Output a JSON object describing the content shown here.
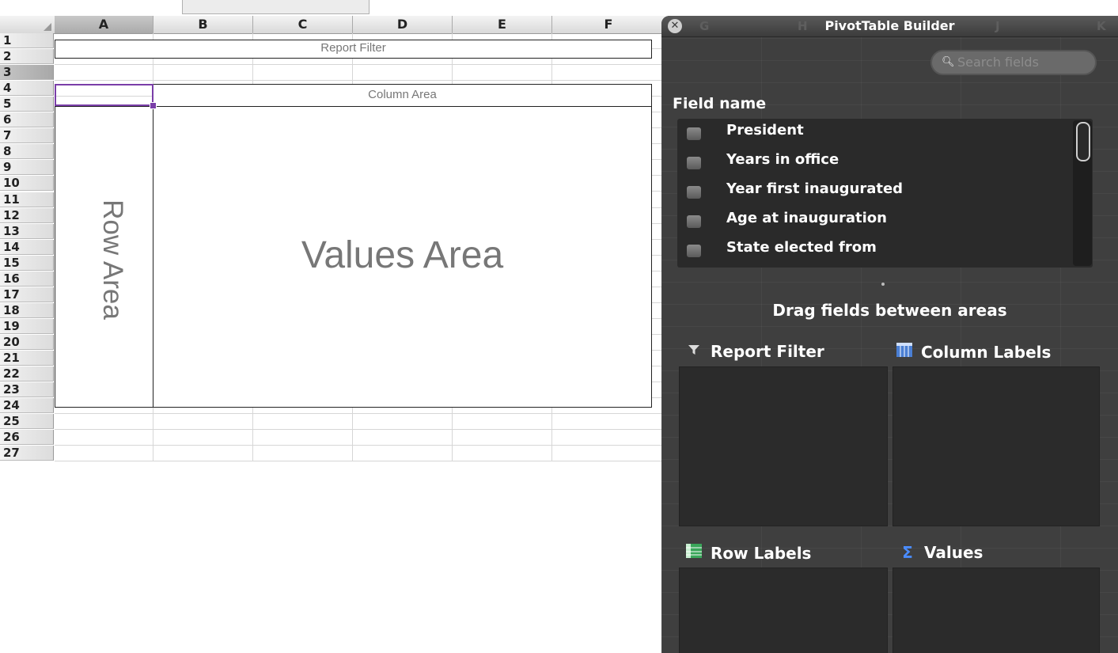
{
  "sheet": {
    "columns": [
      "A",
      "B",
      "C",
      "D",
      "E",
      "F"
    ],
    "rows": [
      "1",
      "2",
      "3",
      "4",
      "5",
      "6",
      "7",
      "8",
      "9",
      "10",
      "11",
      "12",
      "13",
      "14",
      "15",
      "16",
      "17",
      "18",
      "19",
      "20",
      "21",
      "22",
      "23",
      "24",
      "25",
      "26",
      "27"
    ],
    "report_filter": "Report Filter",
    "column_area": "Column Area",
    "row_area": "Row Area",
    "values_area": "Values Area"
  },
  "panel": {
    "title": "PivotTable Builder",
    "ghost_columns": [
      "G",
      "H",
      "J",
      "K"
    ],
    "close_icon": "close-icon",
    "search_placeholder": "Search fields",
    "field_name_label": "Field name",
    "fields": [
      "President",
      "Years in office",
      "Year first inaugurated",
      "Age at inauguration",
      "State elected from"
    ],
    "drag_hint": "Drag fields between areas",
    "areas": {
      "report_filter": {
        "label": "Report Filter",
        "icon": "funnel-icon"
      },
      "column_labels": {
        "label": "Column Labels",
        "icon": "column-labels-icon"
      },
      "row_labels": {
        "label": "Row Labels",
        "icon": "row-labels-icon"
      },
      "values": {
        "label": "Values",
        "icon": "sigma-icon"
      }
    }
  }
}
